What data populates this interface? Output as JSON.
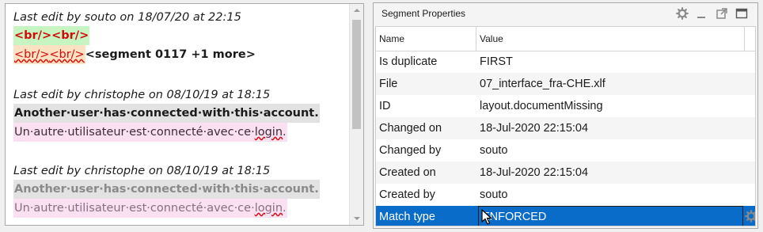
{
  "editor": {
    "blocks": [
      {
        "meta": "Last edit by souto on 18/07/20 at 22:15",
        "green_tags": "<br/><br/>",
        "orange_tag1": "<br/>",
        "orange_tag2": "<br/>",
        "segment_ref": "<segment 0117 +1 more>"
      },
      {
        "meta": "Last edit by christophe on 08/10/19 at 18:15",
        "source": "Another·user·has·connected·with·this·account.",
        "target_a": "Un·autre·utilisateur·est·connecté·avec·ce·",
        "target_b": "login",
        "target_c": "."
      },
      {
        "meta": "Last edit by christophe on 08/10/19 at 18:15",
        "source": "Another·user·has·connected·with·this·account.",
        "target_a": "Un·autre·utilisateur·est·connecté·avec·ce·",
        "target_b": "login",
        "target_c": "."
      }
    ]
  },
  "properties": {
    "title": "Segment Properties",
    "columns": {
      "name": "Name",
      "value": "Value"
    },
    "rows": [
      {
        "name": "Is duplicate",
        "value": "FIRST"
      },
      {
        "name": "File",
        "value": "07_interface_fra-CHE.xlf"
      },
      {
        "name": "ID",
        "value": "layout.documentMissing"
      },
      {
        "name": "Changed on",
        "value": "18-Jul-2020 22:15:04"
      },
      {
        "name": "Changed by",
        "value": "souto"
      },
      {
        "name": "Created on",
        "value": "18-Jul-2020 22:15:04"
      },
      {
        "name": "Created by",
        "value": "souto"
      },
      {
        "name": "Match type",
        "value": "ENFORCED"
      }
    ]
  },
  "colors": {
    "selection": "#0a6cc9",
    "tag_red": "#d10b0b",
    "green_bg": "#c6f5c2",
    "orange_bg": "#fde1c3",
    "pink_bg": "#fbe0f1",
    "grey_bg": "#e2e2e2"
  },
  "icons": {
    "header": [
      "gear-icon",
      "minimize-icon",
      "external-window-icon",
      "maximize-icon"
    ],
    "row": "gear-icon",
    "pointer": "mouse-cursor-icon"
  }
}
